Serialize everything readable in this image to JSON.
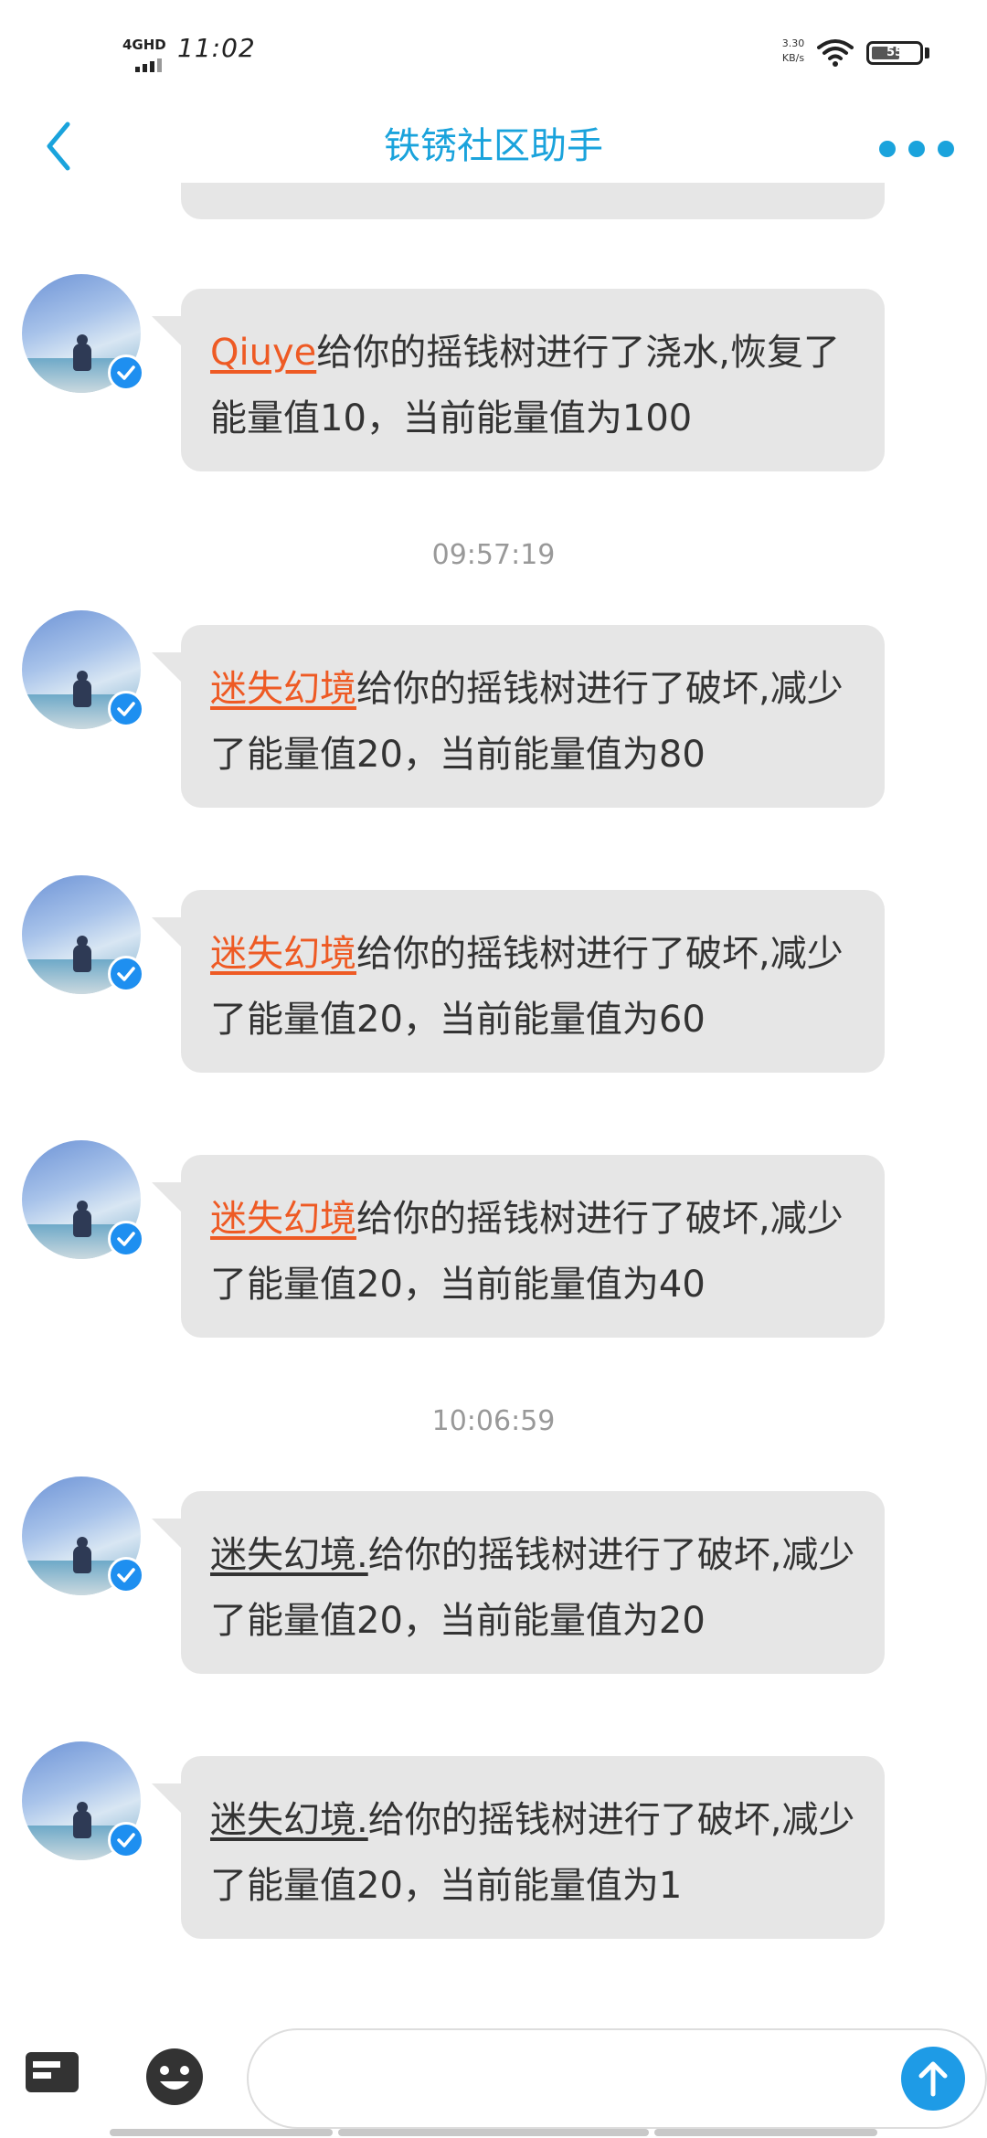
{
  "status_bar": {
    "network": "4GHD",
    "time": "11:02",
    "net_speed_value": "3.30",
    "net_speed_unit": "KB/s",
    "battery": "55"
  },
  "header": {
    "title": "铁锈社区助手",
    "accent_color": "#1aa3dc"
  },
  "messages": [
    {
      "name": "Qiuye",
      "text": "给你的摇钱树进行了浇水,恢复了能量值10，当前能量值为100"
    },
    {
      "name": "迷失幻境",
      "text": "给你的摇钱树进行了破坏,减少了能量值20，当前能量值为80"
    },
    {
      "name": "迷失幻境",
      "text": "给你的摇钱树进行了破坏,减少了能量值20，当前能量值为60"
    },
    {
      "name": "迷失幻境",
      "text": "给你的摇钱树进行了破坏,减少了能量值20，当前能量值为40"
    },
    {
      "name": "迷失幻境.",
      "text": "给你的摇钱树进行了破坏,减少了能量值20，当前能量值为20"
    },
    {
      "name": "迷失幻境.",
      "text": "给你的摇钱树进行了破坏,减少了能量值20，当前能量值为1"
    }
  ],
  "timestamps": [
    "09:57:19",
    "10:06:59"
  ],
  "bottom_bar": {
    "input_value": "",
    "icons": [
      "keyboard-icon",
      "emoji-icon",
      "send-icon"
    ]
  }
}
